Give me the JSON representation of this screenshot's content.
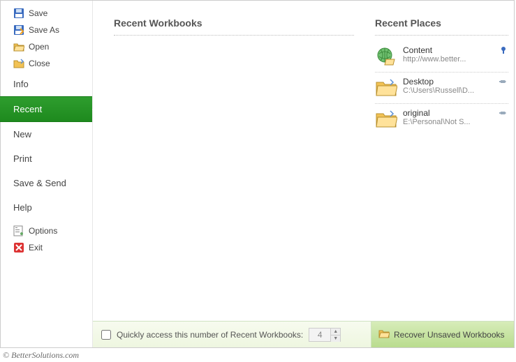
{
  "sidebar": {
    "top": [
      {
        "label": "Save",
        "icon": "save-icon"
      },
      {
        "label": "Save As",
        "icon": "saveas-icon"
      },
      {
        "label": "Open",
        "icon": "open-icon"
      },
      {
        "label": "Close",
        "icon": "close-icon"
      }
    ],
    "mid": [
      {
        "label": "Info"
      },
      {
        "label": "Recent",
        "selected": true
      },
      {
        "label": "New"
      },
      {
        "label": "Print"
      },
      {
        "label": "Save & Send"
      },
      {
        "label": "Help"
      }
    ],
    "bottom": [
      {
        "label": "Options",
        "icon": "options-icon"
      },
      {
        "label": "Exit",
        "icon": "exit-icon"
      }
    ]
  },
  "main": {
    "recent_workbooks_title": "Recent Workbooks",
    "recent_places_title": "Recent Places",
    "places": [
      {
        "name": "Content",
        "path": "http://www.better...",
        "icon": "globe-folder-icon",
        "pinned": true
      },
      {
        "name": "Desktop",
        "path": "C:\\Users\\Russell\\D...",
        "icon": "folder-icon",
        "pinned": false
      },
      {
        "name": "original",
        "path": "E:\\Personal\\Not S...",
        "icon": "folder-icon",
        "pinned": false
      }
    ]
  },
  "footer": {
    "quick_access_label": "Quickly access this number of Recent Workbooks:",
    "quick_access_value": "4",
    "recover_label": "Recover Unsaved Workbooks"
  },
  "watermark": "© BetterSolutions.com"
}
